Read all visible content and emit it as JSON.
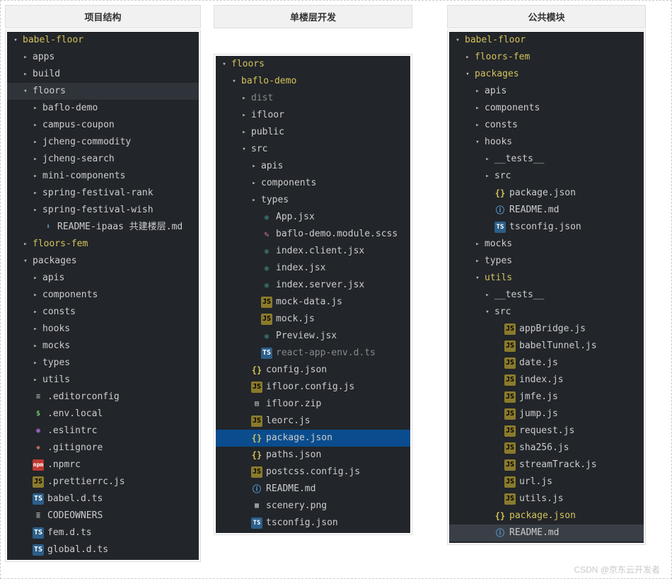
{
  "watermark": "CSDN @京东云开发者",
  "columns": [
    {
      "title": "项目结构",
      "tree": [
        {
          "depth": 0,
          "chev": "open",
          "label": "babel-floor",
          "color": "yellow"
        },
        {
          "depth": 1,
          "chev": "closed",
          "label": "apps"
        },
        {
          "depth": 1,
          "chev": "closed",
          "label": "build"
        },
        {
          "depth": 1,
          "chev": "open",
          "label": "floors",
          "hl": true
        },
        {
          "depth": 2,
          "chev": "closed",
          "label": "baflo-demo"
        },
        {
          "depth": 2,
          "chev": "closed",
          "label": "campus-coupon"
        },
        {
          "depth": 2,
          "chev": "closed",
          "label": "jcheng-commodity"
        },
        {
          "depth": 2,
          "chev": "closed",
          "label": "jcheng-search"
        },
        {
          "depth": 2,
          "chev": "closed",
          "label": "mini-components"
        },
        {
          "depth": 2,
          "chev": "closed",
          "label": "spring-festival-rank"
        },
        {
          "depth": 2,
          "chev": "closed",
          "label": "spring-festival-wish"
        },
        {
          "depth": 2,
          "icon": "dl",
          "label": "README-ipaas 共建楼层.md"
        },
        {
          "depth": 1,
          "chev": "closed",
          "label": "floors-fem",
          "color": "yellow"
        },
        {
          "depth": 1,
          "chev": "open",
          "label": "packages"
        },
        {
          "depth": 2,
          "chev": "closed",
          "label": "apis"
        },
        {
          "depth": 2,
          "chev": "closed",
          "label": "components"
        },
        {
          "depth": 2,
          "chev": "closed",
          "label": "consts"
        },
        {
          "depth": 2,
          "chev": "closed",
          "label": "hooks"
        },
        {
          "depth": 2,
          "chev": "closed",
          "label": "mocks"
        },
        {
          "depth": 2,
          "chev": "closed",
          "label": "types"
        },
        {
          "depth": 2,
          "chev": "closed",
          "label": "utils"
        },
        {
          "depth": 1,
          "icon": "edc",
          "label": ".editorconfig"
        },
        {
          "depth": 1,
          "icon": "env",
          "label": ".env.local"
        },
        {
          "depth": 1,
          "icon": "esl",
          "label": ".eslintrc"
        },
        {
          "depth": 1,
          "icon": "git",
          "label": ".gitignore"
        },
        {
          "depth": 1,
          "icon": "npm",
          "label": ".npmrc"
        },
        {
          "depth": 1,
          "icon": "js",
          "label": ".prettierrc.js"
        },
        {
          "depth": 1,
          "icon": "ts",
          "label": "babel.d.ts"
        },
        {
          "depth": 1,
          "icon": "own",
          "label": "CODEOWNERS"
        },
        {
          "depth": 1,
          "icon": "ts",
          "label": "fem.d.ts"
        },
        {
          "depth": 1,
          "icon": "ts",
          "label": "global.d.ts"
        }
      ]
    },
    {
      "title": "单楼层开发",
      "topPad": true,
      "tree": [
        {
          "depth": 0,
          "chev": "open",
          "label": "floors",
          "color": "yellow"
        },
        {
          "depth": 1,
          "chev": "open",
          "label": "baflo-demo",
          "color": "yellow"
        },
        {
          "depth": 2,
          "chev": "closed",
          "label": "dist",
          "color": "grey"
        },
        {
          "depth": 2,
          "chev": "closed",
          "label": "ifloor"
        },
        {
          "depth": 2,
          "chev": "closed",
          "label": "public"
        },
        {
          "depth": 2,
          "chev": "open",
          "label": "src"
        },
        {
          "depth": 3,
          "chev": "closed",
          "label": "apis"
        },
        {
          "depth": 3,
          "chev": "closed",
          "label": "components"
        },
        {
          "depth": 3,
          "chev": "closed",
          "label": "types"
        },
        {
          "depth": 3,
          "icon": "react",
          "label": "App.jsx"
        },
        {
          "depth": 3,
          "icon": "scss",
          "label": "baflo-demo.module.scss"
        },
        {
          "depth": 3,
          "icon": "react",
          "label": "index.client.jsx"
        },
        {
          "depth": 3,
          "icon": "react",
          "label": "index.jsx"
        },
        {
          "depth": 3,
          "icon": "react",
          "label": "index.server.jsx"
        },
        {
          "depth": 3,
          "icon": "js",
          "label": "mock-data.js"
        },
        {
          "depth": 3,
          "icon": "js",
          "label": "mock.js"
        },
        {
          "depth": 3,
          "icon": "react",
          "label": "Preview.jsx"
        },
        {
          "depth": 3,
          "icon": "ts",
          "label": "react-app-env.d.ts",
          "color": "grey"
        },
        {
          "depth": 2,
          "icon": "json",
          "label": "config.json"
        },
        {
          "depth": 2,
          "icon": "js",
          "label": "ifloor.config.js"
        },
        {
          "depth": 2,
          "icon": "zip",
          "label": "ifloor.zip"
        },
        {
          "depth": 2,
          "icon": "js",
          "label": "leorc.js"
        },
        {
          "depth": 2,
          "icon": "json",
          "label": "package.json",
          "selected": true
        },
        {
          "depth": 2,
          "icon": "json",
          "label": "paths.json"
        },
        {
          "depth": 2,
          "icon": "js",
          "label": "postcss.config.js"
        },
        {
          "depth": 2,
          "icon": "md",
          "label": "README.md"
        },
        {
          "depth": 2,
          "icon": "png",
          "label": "scenery.png"
        },
        {
          "depth": 2,
          "icon": "tsc",
          "label": "tsconfig.json"
        }
      ]
    },
    {
      "title": "公共模块",
      "tree": [
        {
          "depth": 0,
          "chev": "open",
          "label": "babel-floor",
          "color": "yellow"
        },
        {
          "depth": 1,
          "chev": "closed",
          "label": "floors-fem",
          "color": "yellow"
        },
        {
          "depth": 1,
          "chev": "open",
          "label": "packages",
          "color": "yellow"
        },
        {
          "depth": 2,
          "chev": "closed",
          "label": "apis"
        },
        {
          "depth": 2,
          "chev": "closed",
          "label": "components"
        },
        {
          "depth": 2,
          "chev": "closed",
          "label": "consts"
        },
        {
          "depth": 2,
          "chev": "open",
          "label": "hooks"
        },
        {
          "depth": 3,
          "chev": "closed",
          "label": "__tests__"
        },
        {
          "depth": 3,
          "chev": "closed",
          "label": "src"
        },
        {
          "depth": 3,
          "icon": "json",
          "label": "package.json"
        },
        {
          "depth": 3,
          "icon": "md",
          "label": "README.md"
        },
        {
          "depth": 3,
          "icon": "tsc",
          "label": "tsconfig.json"
        },
        {
          "depth": 2,
          "chev": "closed",
          "label": "mocks"
        },
        {
          "depth": 2,
          "chev": "closed",
          "label": "types"
        },
        {
          "depth": 2,
          "chev": "open",
          "label": "utils",
          "color": "yellow"
        },
        {
          "depth": 3,
          "chev": "closed",
          "label": "__tests__"
        },
        {
          "depth": 3,
          "chev": "open",
          "label": "src"
        },
        {
          "depth": 4,
          "icon": "js",
          "label": "appBridge.js"
        },
        {
          "depth": 4,
          "icon": "js",
          "label": "babelTunnel.js"
        },
        {
          "depth": 4,
          "icon": "js",
          "label": "date.js"
        },
        {
          "depth": 4,
          "icon": "js",
          "label": "index.js"
        },
        {
          "depth": 4,
          "icon": "js",
          "label": "jmfe.js"
        },
        {
          "depth": 4,
          "icon": "js",
          "label": "jump.js"
        },
        {
          "depth": 4,
          "icon": "js",
          "label": "request.js"
        },
        {
          "depth": 4,
          "icon": "js",
          "label": "sha256.js"
        },
        {
          "depth": 4,
          "icon": "js",
          "label": "streamTrack.js"
        },
        {
          "depth": 4,
          "icon": "js",
          "label": "url.js"
        },
        {
          "depth": 4,
          "icon": "js",
          "label": "utils.js"
        },
        {
          "depth": 3,
          "icon": "json",
          "label": "package.json",
          "color": "yellow"
        },
        {
          "depth": 3,
          "icon": "md",
          "label": "README.md",
          "dim": true
        }
      ]
    }
  ]
}
